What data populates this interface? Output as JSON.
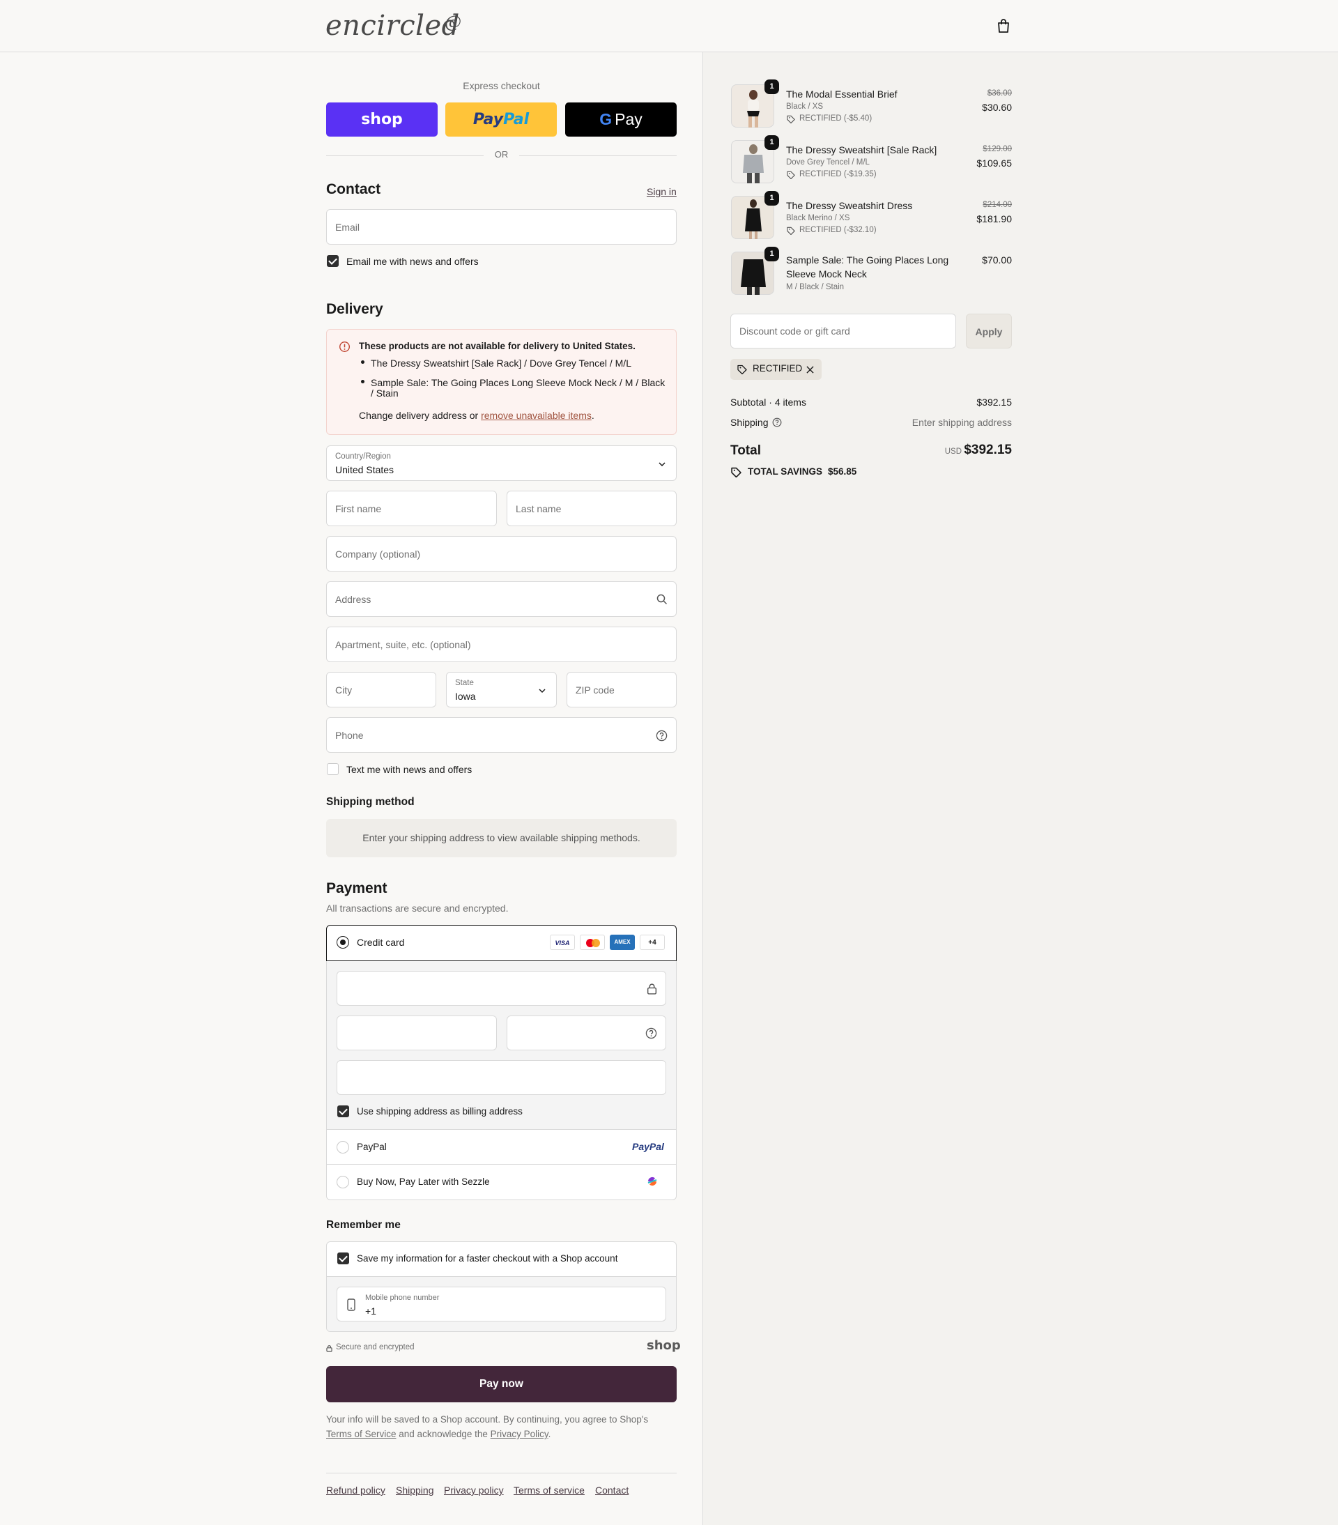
{
  "header": {
    "logo": "encircled",
    "logo_mark": "@",
    "cart_icon": "bag-icon"
  },
  "express": {
    "label": "Express checkout",
    "shop_label": "shop",
    "paypal_label_a": "Pay",
    "paypal_label_b": "Pal",
    "gpay_g": "G",
    "gpay_label": "Pay",
    "or": "OR"
  },
  "contact": {
    "title": "Contact",
    "sign_in": "Sign in",
    "email_placeholder": "Email",
    "news_label": "Email me with news and offers"
  },
  "delivery": {
    "title": "Delivery",
    "alert_title": "These products are not available for delivery to United States.",
    "alert_items": [
      "The Dressy Sweatshirt [Sale Rack] / Dove Grey Tencel / M/L",
      "Sample Sale: The Going Places Long Sleeve Mock Neck / M / Black",
      "/ Stain"
    ],
    "alert_footer_pre": "Change delivery address or ",
    "alert_footer_link": "remove unavailable items",
    "alert_footer_post": ".",
    "country_label": "Country/Region",
    "country_value": "United States",
    "first_name": "First name",
    "last_name": "Last name",
    "company": "Company (optional)",
    "address": "Address",
    "apartment": "Apartment, suite, etc. (optional)",
    "city": "City",
    "state_label": "State",
    "state_value": "Iowa",
    "zip": "ZIP code",
    "phone": "Phone",
    "text_news": "Text me with news and offers"
  },
  "shipping_method": {
    "title": "Shipping method",
    "message": "Enter your shipping address to view available shipping methods."
  },
  "payment": {
    "title": "Payment",
    "subtitle": "All transactions are secure and encrypted.",
    "credit_card": "Credit card",
    "card_logos": [
      "VISA",
      "AMEX",
      "+4"
    ],
    "billing_label": "Use shipping address as billing address",
    "paypal": "PayPal",
    "paypal_logo": "PayPal",
    "sezzle": "Buy Now, Pay Later with Sezzle"
  },
  "remember": {
    "title": "Remember me",
    "save_label": "Save my information for a faster checkout with a Shop account",
    "mobile_label": "Mobile phone number",
    "mobile_value": "+1",
    "secure": "Secure and encrypted",
    "shop": "shop"
  },
  "pay_button": "Pay now",
  "legal": {
    "line1": "Your info will be saved to a Shop account. By continuing, you agree to Shop's",
    "tos": "Terms of Service",
    "mid": " and acknowledge the ",
    "privacy": "Privacy Policy",
    "end": "."
  },
  "footer": [
    "Refund policy",
    "Shipping",
    "Privacy policy",
    "Terms of service",
    "Contact"
  ],
  "summary": {
    "items": [
      {
        "name": "The Modal Essential Brief",
        "variant": "Black / XS",
        "discount": "RECTIFIED (-$5.40)",
        "old": "$36.00",
        "price": "$30.60",
        "qty": "1"
      },
      {
        "name": "The Dressy Sweatshirt [Sale Rack]",
        "variant": "Dove Grey Tencel / M/L",
        "discount": "RECTIFIED (-$19.35)",
        "old": "$129.00",
        "price": "$109.65",
        "qty": "1"
      },
      {
        "name": "The Dressy Sweatshirt Dress",
        "variant": "Black Merino / XS",
        "discount": "RECTIFIED (-$32.10)",
        "old": "$214.00",
        "price": "$181.90",
        "qty": "1"
      },
      {
        "name_a": "Sample Sale: The Going Places Long",
        "name_b": "Sleeve Mock Neck",
        "variant": "M / Black / Stain",
        "price": "$70.00",
        "qty": "1"
      }
    ],
    "discount_placeholder": "Discount code or gift card",
    "apply": "Apply",
    "tag": "RECTIFIED",
    "subtotal_label": "Subtotal · 4 items",
    "subtotal": "$392.15",
    "shipping_label": "Shipping",
    "shipping_value": "Enter shipping address",
    "total_label": "Total",
    "currency": "USD",
    "total": "$392.15",
    "savings_label": "TOTAL SAVINGS",
    "savings": "$56.85"
  },
  "colors": {
    "shop": "#5a31f4",
    "paypal": "#ffc439",
    "pay_button": "#43263a",
    "alert_bg": "#fdf3f1",
    "alert_border": "#f3d3cd"
  }
}
